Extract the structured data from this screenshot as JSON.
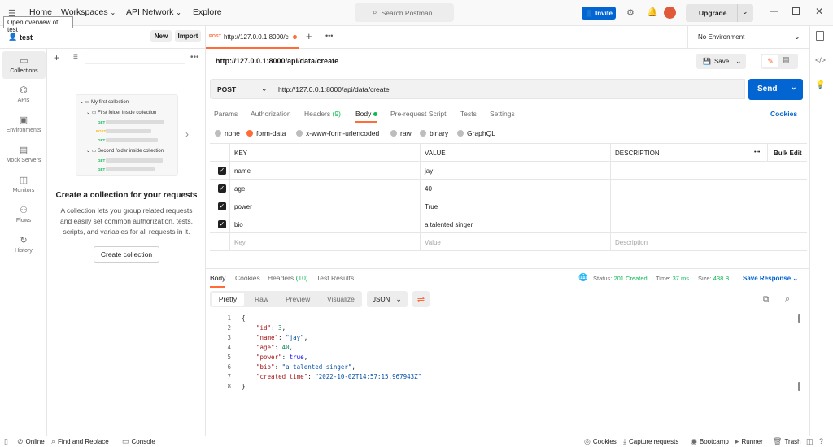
{
  "topbar": {
    "nav": [
      "Home",
      "Workspaces",
      "API Network",
      "Explore"
    ],
    "search_placeholder": "Search Postman",
    "invite_label": "Invite",
    "upgrade_label": "Upgrade",
    "tooltip": "Open overview of test"
  },
  "workspace": {
    "name": "test",
    "new_label": "New",
    "import_label": "Import"
  },
  "rail": [
    {
      "label": "Collections",
      "icon": "collections-icon",
      "active": true
    },
    {
      "label": "APIs",
      "icon": "apis-icon"
    },
    {
      "label": "Environments",
      "icon": "environments-icon"
    },
    {
      "label": "Mock Servers",
      "icon": "mock-servers-icon"
    },
    {
      "label": "Monitors",
      "icon": "monitors-icon"
    },
    {
      "label": "Flows",
      "icon": "flows-icon"
    },
    {
      "label": "History",
      "icon": "history-icon"
    }
  ],
  "empty_state": {
    "illustration": {
      "collection": "My first collection",
      "folder1": "First folder inside collection",
      "folder2": "Second folder inside collection",
      "get": "GET",
      "post": "POST"
    },
    "title": "Create a collection for your requests",
    "description": "A collection lets you group related requests and easily set common authorization, tests, scripts, and variables for all requests in it.",
    "button": "Create collection"
  },
  "tab": {
    "method": "POST",
    "title": "http://127.0.0.1:8000/c"
  },
  "environment": "No Environment",
  "request": {
    "title": "http://127.0.0.1:8000/api/data/create",
    "save_label": "Save",
    "method": "POST",
    "url": "http://127.0.0.1:8000/api/data/create",
    "send_label": "Send",
    "tabs": [
      "Params",
      "Authorization",
      "Headers",
      "Body",
      "Pre-request Script",
      "Tests",
      "Settings"
    ],
    "headers_count": "(9)",
    "cookies_link": "Cookies",
    "body_types": [
      "none",
      "form-data",
      "x-www-form-urlencoded",
      "raw",
      "binary",
      "GraphQL"
    ],
    "table": {
      "headers": [
        "KEY",
        "VALUE",
        "DESCRIPTION"
      ],
      "bulk_edit": "Bulk Edit",
      "rows": [
        {
          "key": "name",
          "value": "jay"
        },
        {
          "key": "age",
          "value": "40"
        },
        {
          "key": "power",
          "value": "True"
        },
        {
          "key": "bio",
          "value": "a talented singer"
        }
      ],
      "placeholder": {
        "key": "Key",
        "value": "Value",
        "description": "Description"
      }
    }
  },
  "response": {
    "tabs": [
      "Body",
      "Cookies",
      "Headers",
      "Test Results"
    ],
    "headers_count": "(10)",
    "status_label": "Status:",
    "status_value": "201 Created",
    "time_label": "Time:",
    "time_value": "37 ms",
    "size_label": "Size:",
    "size_value": "438 B",
    "save_response": "Save Response",
    "view_tabs": [
      "Pretty",
      "Raw",
      "Preview",
      "Visualize"
    ],
    "format": "JSON",
    "line_numbers": [
      "1",
      "2",
      "3",
      "4",
      "5",
      "6",
      "7",
      "8"
    ],
    "code": {
      "open": "{",
      "close": "}",
      "id_key": "\"id\"",
      "id_val": "3",
      "name_key": "\"name\"",
      "name_val": "\"jay\"",
      "age_key": "\"age\"",
      "age_val": "40",
      "power_key": "\"power\"",
      "power_val": "true",
      "bio_key": "\"bio\"",
      "bio_val": "\"a talented singer\"",
      "ct_key": "\"created_time\"",
      "ct_val": "\"2022-10-02T14:57:15.967943Z\""
    }
  },
  "statusbar": {
    "online": "Online",
    "find_replace": "Find and Replace",
    "console": "Console",
    "cookies": "Cookies",
    "capture": "Capture requests",
    "bootcamp": "Bootcamp",
    "runner": "Runner",
    "trash": "Trash"
  },
  "colors": {
    "accent": "#ff6c37",
    "primary": "#0265d2",
    "success": "#0cbb52"
  }
}
